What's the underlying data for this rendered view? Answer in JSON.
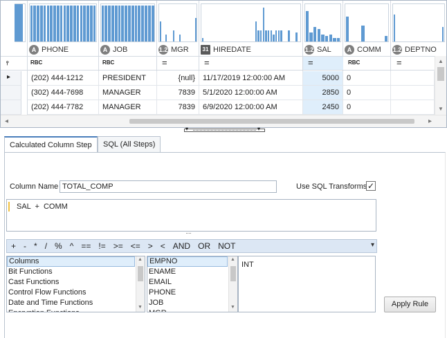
{
  "grid": {
    "columns": [
      {
        "name": "",
        "type_icon": ""
      },
      {
        "name": "PHONE",
        "type_icon": "A"
      },
      {
        "name": "JOB",
        "type_icon": "A"
      },
      {
        "name": "MGR",
        "type_icon": "1.2"
      },
      {
        "name": "HIREDATE",
        "type_icon": "31"
      },
      {
        "name": "SAL",
        "type_icon": "1.2"
      },
      {
        "name": "COMM",
        "type_icon": "A"
      },
      {
        "name": "DEPTNO",
        "type_icon": "1.2"
      }
    ],
    "filter_icons": {
      "text": "RBC",
      "equals": "="
    },
    "rows": [
      {
        "phone": "(202) 444-1212",
        "job": "PRESIDENT",
        "mgr": "{null}",
        "hiredate": "11/17/2019 12:00:00 AM",
        "sal": "5000",
        "comm": "0",
        "deptno": ""
      },
      {
        "phone": "(302) 444-7698",
        "job": "MANAGER",
        "mgr": "7839",
        "hiredate": "5/1/2020 12:00:00 AM",
        "sal": "2850",
        "comm": "0",
        "deptno": ""
      },
      {
        "phone": "(202) 444-7782",
        "job": "MANAGER",
        "mgr": "7839",
        "hiredate": "6/9/2020 12:00:00 AM",
        "sal": "2450",
        "comm": "0",
        "deptno": ""
      }
    ],
    "current_row_marker": "▸",
    "bar_color": "#5f9ad2",
    "highlight_color": "#dfeefb"
  },
  "tabs": [
    {
      "label": "Calculated Column Step",
      "active": true
    },
    {
      "label": "SQL (All Steps)",
      "active": false
    }
  ],
  "form": {
    "column_name_label": "Column Name",
    "column_name_value": "TOTAL_COMP",
    "use_sql_transforms_label": "Use SQL Transforms",
    "use_sql_transforms_checked": "✓",
    "expression_tokens": [
      "SAL",
      "+",
      "COMM"
    ]
  },
  "operators": [
    "+",
    "-",
    "*",
    "/",
    "%",
    "^",
    "==",
    "!=",
    ">=",
    "<=",
    ">",
    "<",
    "AND",
    "OR",
    "NOT"
  ],
  "categories": [
    "Columns",
    "Bit Functions",
    "Cast Functions",
    "Control Flow Functions",
    "Date and Time Functions",
    "Encryption Functions"
  ],
  "selected_category": "Columns",
  "fields": [
    "EMPNO",
    "ENAME",
    "EMAIL",
    "PHONE",
    "JOB",
    "MGR"
  ],
  "selected_field": "EMPNO",
  "field_type": "INT",
  "apply_button_label": "Apply Rule",
  "icons": {
    "collapse": "▾",
    "scroll_up": "▲",
    "scroll_down": "▼",
    "scroll_left": "◂",
    "scroll_right": "▸",
    "splitter_grip": "····"
  }
}
